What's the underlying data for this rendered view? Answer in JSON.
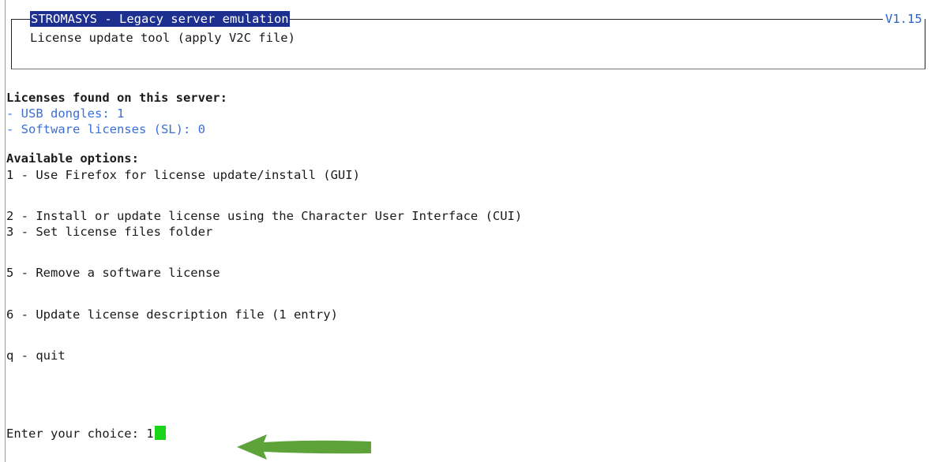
{
  "header": {
    "title": "STROMASYS - Legacy server emulation",
    "version": "V1.15",
    "subtitle": "License update tool (apply V2C file)"
  },
  "licenses": {
    "heading": "Licenses found on this server:",
    "items": [
      "- USB dongles: 1",
      "- Software licenses (SL): 0"
    ]
  },
  "options": {
    "heading": "Available options:",
    "items": [
      "1 - Use Firefox for license update/install (GUI)",
      "2 - Install or update license using the Character User Interface (CUI)",
      "3 - Set license files folder",
      "5 - Remove a software license",
      "6 - Update license description file (1 entry)",
      "q - quit"
    ]
  },
  "prompt": {
    "label": "Enter your choice: ",
    "value": "1"
  },
  "colors": {
    "title_bg": "#1d2f8f",
    "info_text": "#3a6fd8",
    "cursor": "#19d419",
    "arrow": "#5ea33a"
  },
  "icons": {
    "arrow": "green-arrow-icon"
  }
}
